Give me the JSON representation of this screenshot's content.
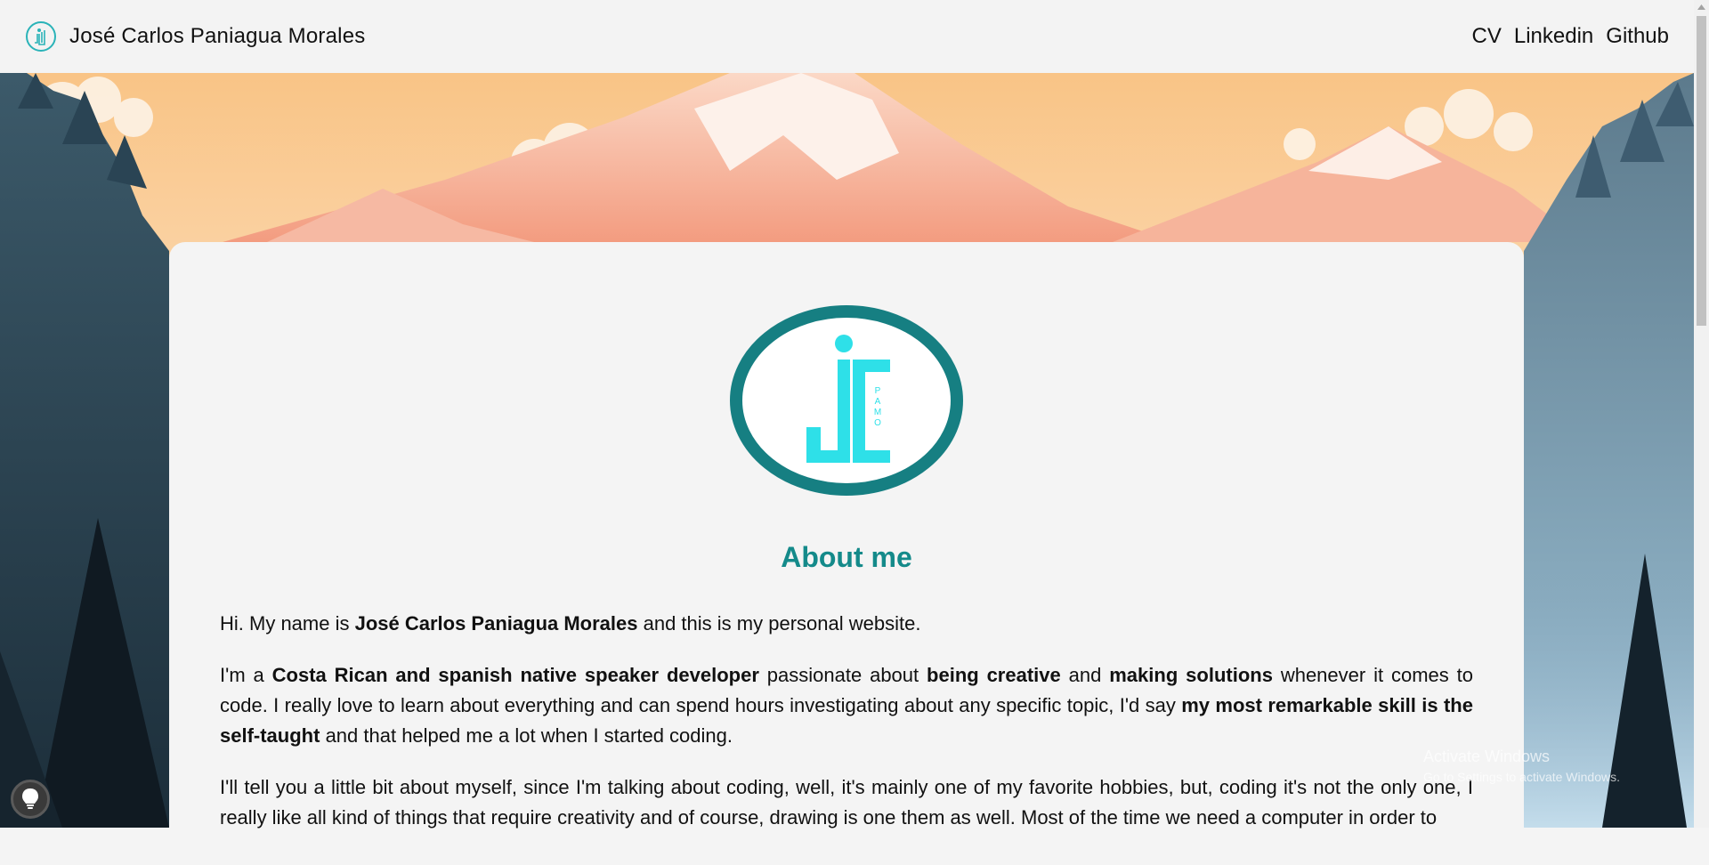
{
  "navbar": {
    "brand_name": "José Carlos Paniagua Morales",
    "logo_icon": "jc-logo-icon",
    "links": [
      {
        "label": "CV"
      },
      {
        "label": "Linkedin"
      },
      {
        "label": "Github"
      }
    ]
  },
  "card": {
    "logo_letters": "jc",
    "logo_sub_letters": "PAMO",
    "title": "About me",
    "paragraphs": {
      "p1": {
        "a": "Hi. My name is ",
        "b": "José Carlos Paniagua Morales",
        "c": " and this is my personal website."
      },
      "p2": {
        "a": "I'm a ",
        "b": "Costa Rican and spanish native speaker developer",
        "c": " passionate about ",
        "d": "being creative",
        "e": " and ",
        "f": "making solutions",
        "g": " whenever it comes to code. I really love to learn about everything and can spend hours investigating about any specific topic, I'd say ",
        "h": "my most remarkable skill is the self-taught",
        "i": " and that helped me a lot when I started coding."
      },
      "p3": {
        "a": "I'll tell you a little bit about myself, since I'm talking about coding, well, it's mainly one of my favorite hobbies, but, coding it's not the only one, I really like all kind of things that require creativity and of course, drawing is one them as well. Most of the time we need a computer in order to"
      }
    }
  },
  "watermark": {
    "title": "Activate Windows",
    "subtitle": "Go to Settings to activate Windows."
  },
  "theme_toggle": {
    "icon": "lightbulb-icon"
  },
  "colors": {
    "accent": "#148a8a",
    "logo_cyan": "#2ee0e8",
    "navbar_bg": "#f3f3f3"
  }
}
